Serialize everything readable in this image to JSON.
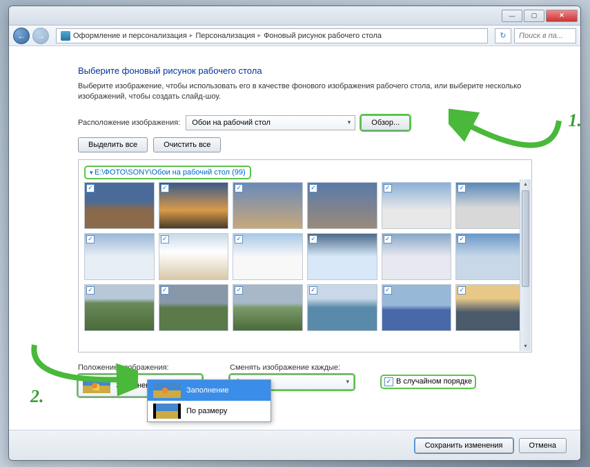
{
  "titlebar": {
    "min": "—",
    "max": "▢",
    "close": "✕"
  },
  "nav": {
    "back": "←",
    "fwd": "→",
    "breadcrumb": [
      "Оформление и персонализация",
      "Персонализация",
      "Фоновый рисунок рабочего стола"
    ],
    "refresh": "↻",
    "search_placeholder": "Поиск в па..."
  },
  "heading": "Выберите фоновый рисунок рабочего стола",
  "description": "Выберите изображение, чтобы использовать его в качестве фонового изображения рабочего стола, или выберите несколько изображений, чтобы создать слайд-шоу.",
  "location_label": "Расположение изображения:",
  "location_value": "Обои на рабочий стол",
  "browse_label": "Обзор...",
  "select_all": "Выделить все",
  "clear_all": "Очистить все",
  "gallery_path": "E:\\ФОТО\\SONY\\Обои на рабочий стол (99)",
  "position_label": "Положение изображения:",
  "position_value": "Заполнение",
  "interval_label": "Сменять изображение каждые:",
  "interval_value": "2 часа",
  "shuffle_label": "В случайном порядке",
  "dropdown": {
    "opt1": "Заполнение",
    "opt2": "По размеру"
  },
  "footer": {
    "save": "Сохранить изменения",
    "cancel": "Отмена"
  },
  "annotations": {
    "n1": "1.",
    "n2": "2."
  },
  "thumbs_gradients": [
    "linear-gradient(#4a6a9a 40%, #8a6a4a 60%)",
    "linear-gradient(#3a5a8a, #d89a4a 60%, #4a3a2a)",
    "linear-gradient(#6a8aba, #c8a87a)",
    "linear-gradient(#5a7aaa, #9a8a7a)",
    "linear-gradient(#8ab0d8, #e8e8e8 60%)",
    "linear-gradient(#5888b8, #d8d8d8 55%)",
    "linear-gradient(#9ab8d8, #e8eef5 50%)",
    "linear-gradient(#c8d8e8, #fff 40%, #d8c8a8)",
    "linear-gradient(#a8c8e8, #f8f8f8 50%)",
    "linear-gradient(#4a6a8a, #d8e8f8 50%)",
    "linear-gradient(#88a8c8, #e8e8f0 50%)",
    "linear-gradient(#6898c8, #c8d8e8 50%)",
    "linear-gradient(#b8c8d8 30%, #6a8a5a 40%, #4a6a3a)",
    "linear-gradient(#8898a8 40%, #5a7a4a 50%)",
    "linear-gradient(#a8b8c8 40%, #7a9a6a 50%, #4a6a3a)",
    "linear-gradient(#c8d8e8 30%, #5a8aaa 50%)",
    "linear-gradient(#98b8d8 45%, #4868aa 55%)",
    "linear-gradient(#e8c888 30%, #4a5a6a 60%)"
  ]
}
